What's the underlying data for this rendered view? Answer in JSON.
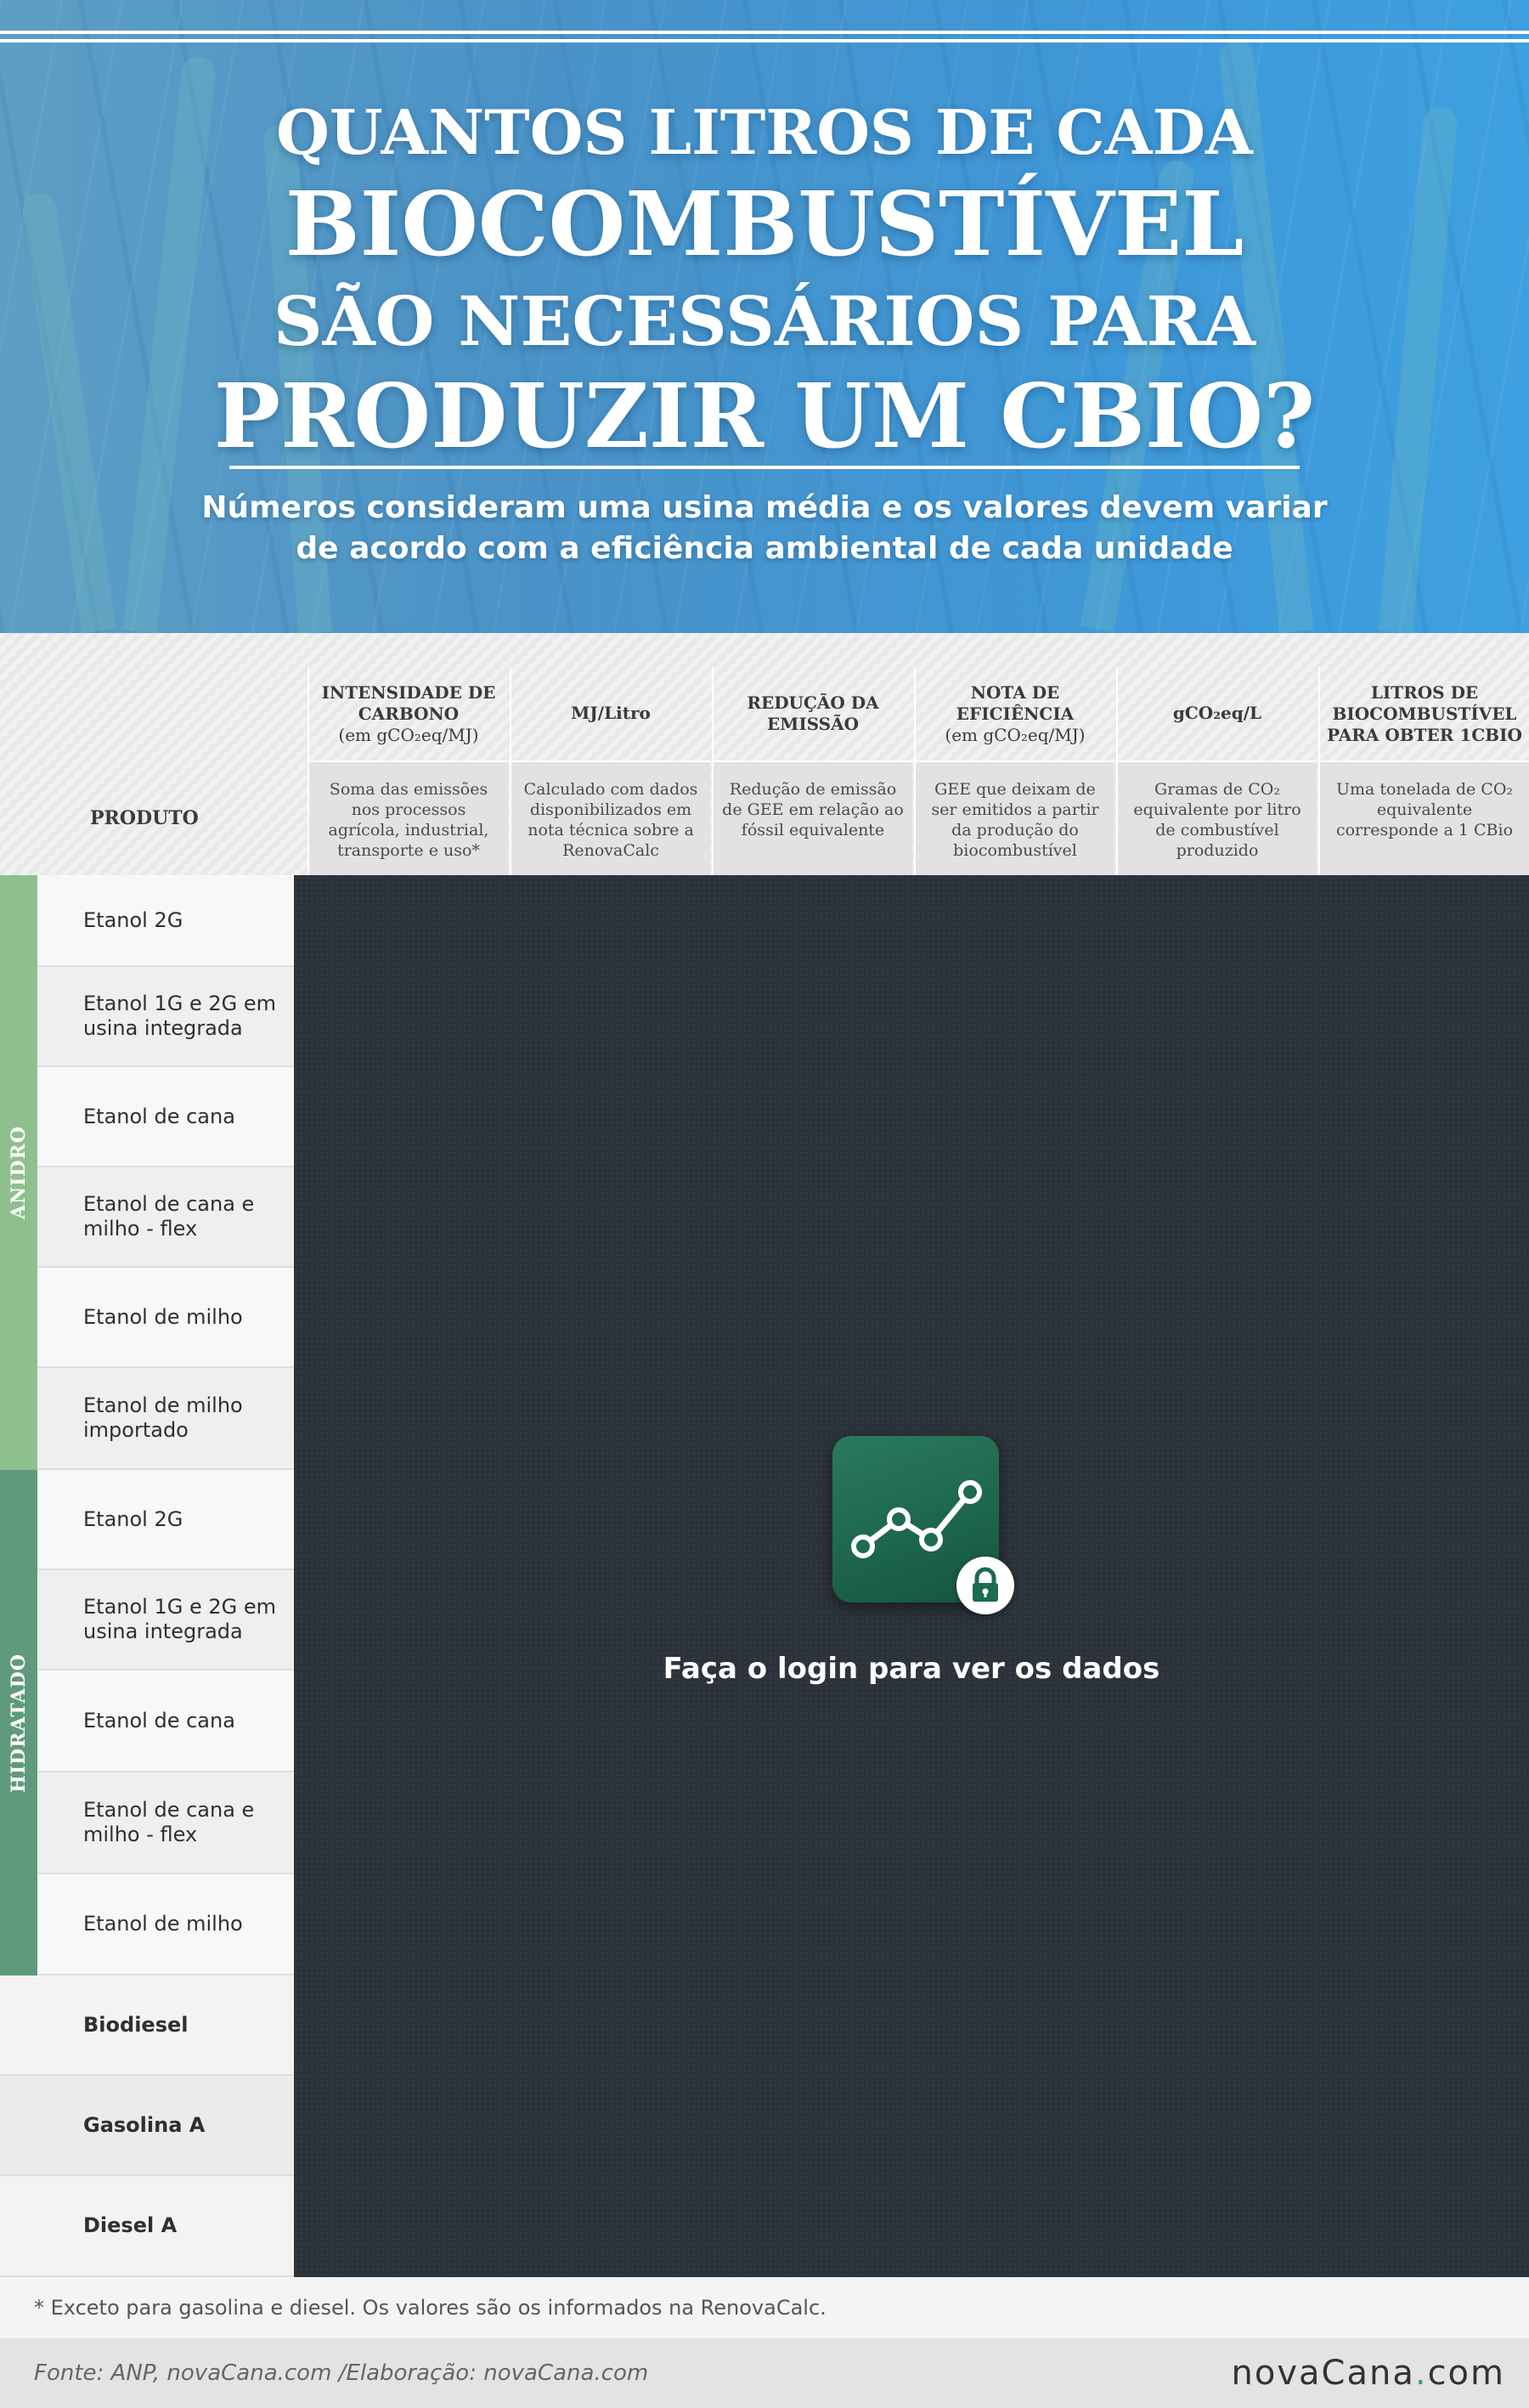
{
  "hero": {
    "title_line1": "QUANTOS LITROS DE CADA",
    "title_line2": "BIOCOMBUSTÍVEL",
    "title_line3": "SÃO NECESSÁRIOS PARA",
    "title_line4": "PRODUZIR UM CBIO?",
    "subtitle_line1": "Números consideram uma usina média e os valores devem variar",
    "subtitle_line2": "de acordo com a eficiência ambiental de cada unidade"
  },
  "table": {
    "produto_label": "PRODUTO",
    "columns": [
      {
        "title": "INTENSIDADE DE CARBONO",
        "unit": "(em gCO₂eq/MJ)",
        "desc": "Soma das emissões nos processos agrícola, industrial, transporte e uso*"
      },
      {
        "title": "MJ/Litro",
        "unit": "",
        "desc": "Calculado com dados disponibilizados em nota técnica sobre a RenovaCalc"
      },
      {
        "title": "REDUÇÃO DA EMISSÃO",
        "unit": "",
        "desc": "Redução de emissão de GEE em relação ao fóssil equivalente"
      },
      {
        "title": "NOTA DE EFICIÊNCIA",
        "unit": "(em gCO₂eq/MJ)",
        "desc": "GEE que deixam de ser emitidos a partir da produção do biocombustível"
      },
      {
        "title": "gCO₂eq/L",
        "unit": "",
        "desc": "Gramas de CO₂ equivalente por litro de combustível produzido"
      },
      {
        "title": "LITROS DE BIOCOMBUSTÍVEL PARA OBTER 1CBIO",
        "unit": "",
        "desc": "Uma tonelada de CO₂ equivalente corresponde a 1 CBio"
      }
    ],
    "groups": [
      {
        "label": "ANIDRO",
        "color": "#8dc08d",
        "items": [
          "Etanol 2G",
          "Etanol 1G e 2G em usina integrada",
          "Etanol de cana",
          "Etanol de cana e milho - flex",
          "Etanol de milho",
          "Etanol de milho importado"
        ]
      },
      {
        "label": "HIDRATADO",
        "color": "#5f9a7d",
        "items": [
          "Etanol 2G",
          "Etanol 1G e 2G em usina integrada",
          "Etanol de cana",
          "Etanol de cana e milho - flex",
          "Etanol de milho"
        ]
      }
    ],
    "other_items": [
      "Biodiesel",
      "Gasolina A",
      "Diesel A"
    ]
  },
  "locked": {
    "message": "Faça o login para ver os dados",
    "icon": "chart-line-icon",
    "badge_icon": "lock-icon",
    "icon_color": "#1e6b4f"
  },
  "footer": {
    "footnote": "* Exceto para gasolina e diesel. Os valores são os informados na RenovaCalc.",
    "source": "Fonte: ANP, novaCana.com /Elaboração: novaCana.com",
    "brand_left": "novaCana",
    "brand_dot": ".",
    "brand_right": "com"
  }
}
